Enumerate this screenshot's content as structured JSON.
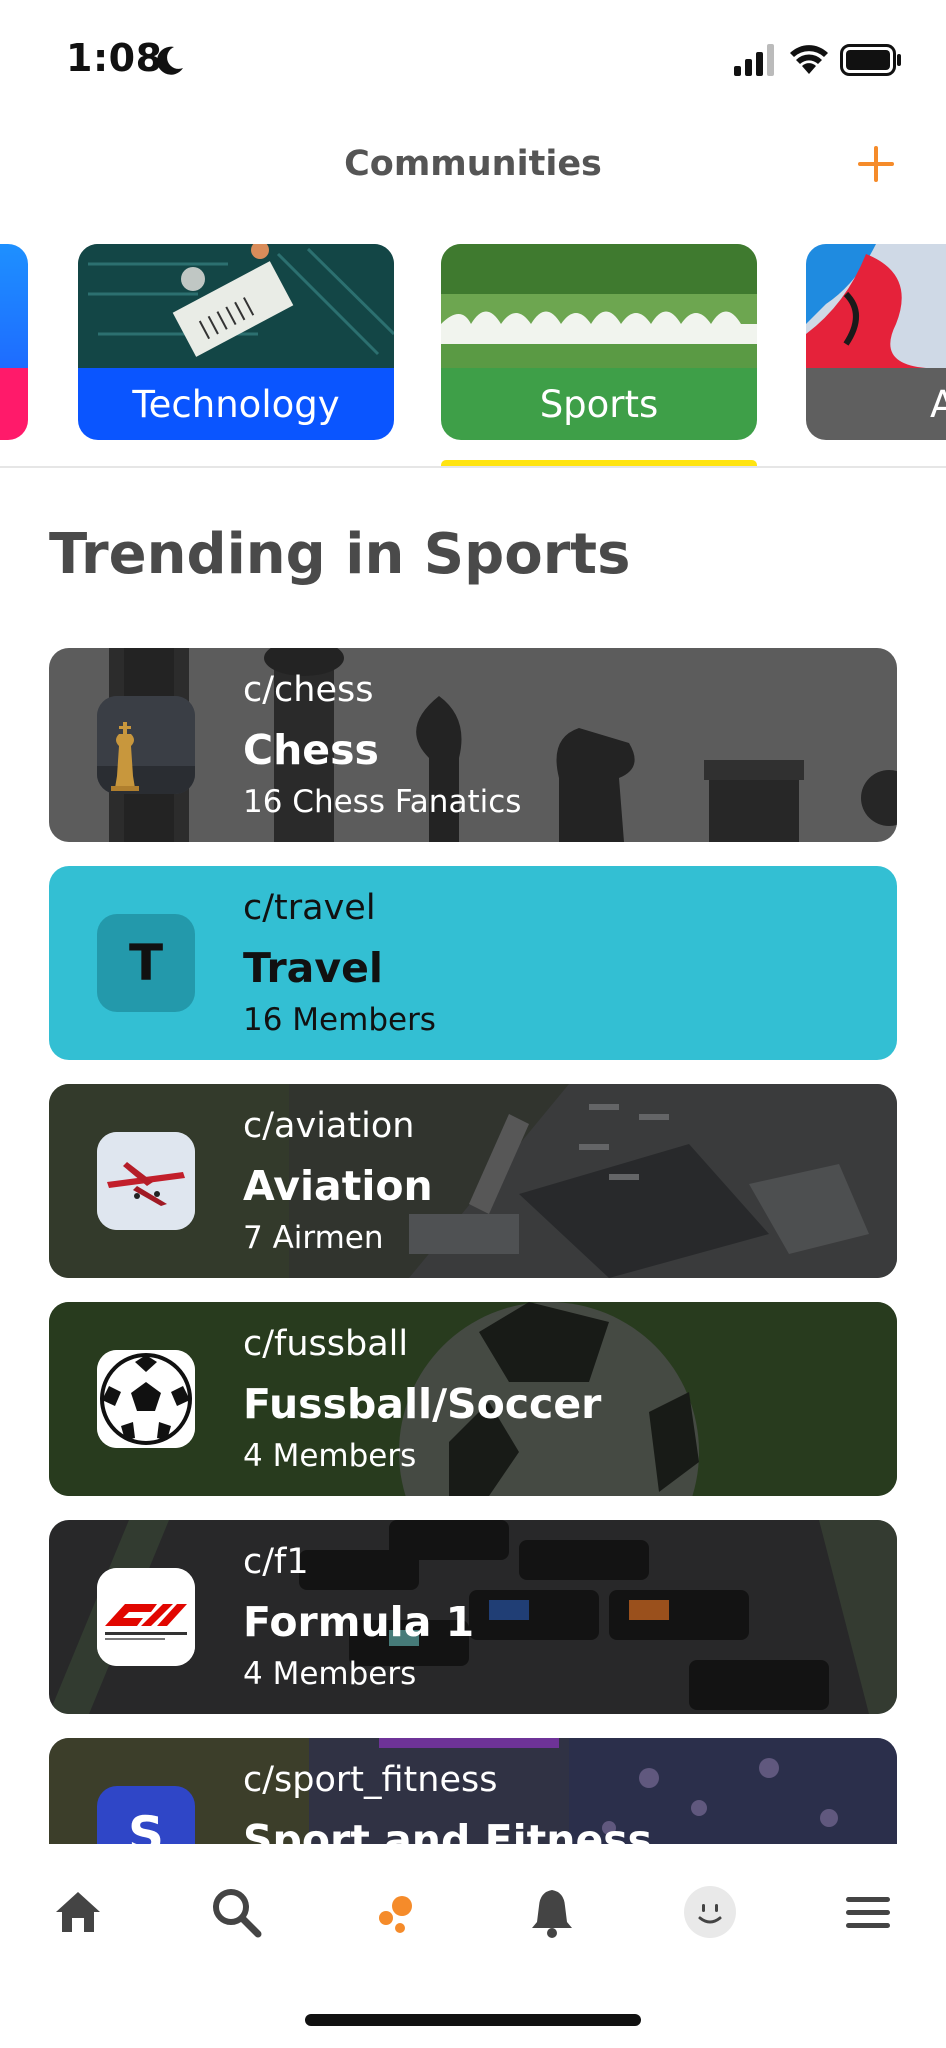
{
  "status_bar": {
    "time": "1:08"
  },
  "header": {
    "title": "Communities"
  },
  "categories": [
    {
      "label": "",
      "color": "#0a6cff"
    },
    {
      "label": "Technology",
      "color": "#0a55ff"
    },
    {
      "label": "Sports",
      "color": "#3e9f48"
    },
    {
      "label": "A",
      "color": "#5f5f5f"
    }
  ],
  "selected_category": "Sports",
  "section": {
    "title": "Trending in Sports"
  },
  "communities": [
    {
      "slug": "c/chess",
      "name": "Chess",
      "count": "16 Chess Fanatics",
      "avatar_letter": ""
    },
    {
      "slug": "c/travel",
      "name": "Travel",
      "count": "16 Members",
      "avatar_letter": "T"
    },
    {
      "slug": "c/aviation",
      "name": "Aviation",
      "count": "7 Airmen",
      "avatar_letter": ""
    },
    {
      "slug": "c/fussball",
      "name": "Fussball/Soccer",
      "count": "4 Members",
      "avatar_letter": ""
    },
    {
      "slug": "c/f1",
      "name": "Formula 1",
      "count": "4 Members",
      "avatar_letter": ""
    },
    {
      "slug": "c/sport_fitness",
      "name": "Sport and Fitness",
      "count": "",
      "avatar_letter": "S"
    }
  ],
  "nav": {
    "items": [
      "home-icon",
      "search-icon",
      "communities-icon",
      "bell-icon",
      "profile-face-icon",
      "menu-icon"
    ],
    "active": "communities-icon"
  },
  "colors": {
    "accent": "#f58b2a",
    "travel_card": "#33bfd3",
    "indicator": "#ffe411"
  }
}
